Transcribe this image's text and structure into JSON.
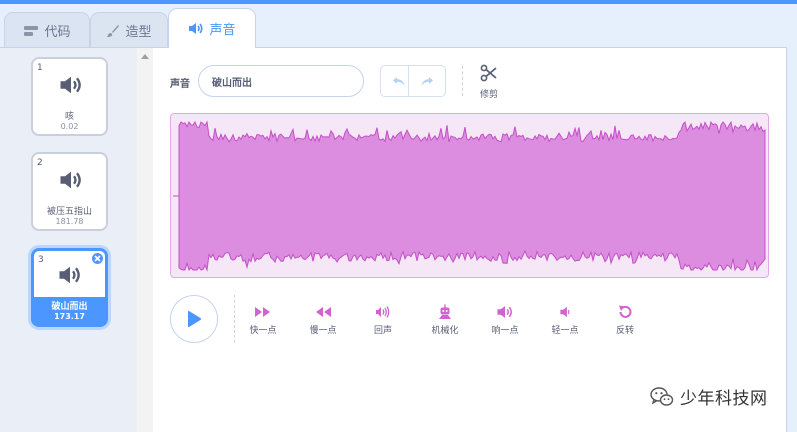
{
  "tabs": [
    {
      "label": "代码",
      "icon": "code-blocks-icon"
    },
    {
      "label": "造型",
      "icon": "paintbrush-icon"
    },
    {
      "label": "声音",
      "icon": "speaker-icon",
      "active": true
    }
  ],
  "sounds": [
    {
      "index": "1",
      "name": "咳",
      "duration": "0.02",
      "icon": "speaker-icon"
    },
    {
      "index": "2",
      "name": "被压五指山",
      "duration": "181.78",
      "icon": "speaker-icon"
    },
    {
      "index": "3",
      "name": "破山而出",
      "duration": "173.17",
      "icon": "speaker-icon",
      "selected": true
    }
  ],
  "editor": {
    "sound_label": "声音",
    "sound_name": "破山而出",
    "trim_label": "修剪",
    "effects": [
      {
        "label": "快一点",
        "icon": "faster-icon"
      },
      {
        "label": "慢一点",
        "icon": "slower-icon"
      },
      {
        "label": "回声",
        "icon": "echo-icon"
      },
      {
        "label": "机械化",
        "icon": "robot-icon"
      },
      {
        "label": "响一点",
        "icon": "louder-icon"
      },
      {
        "label": "轻一点",
        "icon": "softer-icon"
      },
      {
        "label": "反转",
        "icon": "reverse-icon"
      }
    ]
  },
  "watermark": {
    "text": "少年科技网",
    "icon": "wechat-icon"
  },
  "colors": {
    "accent": "#4c97ff",
    "waveform_fill": "#dc8ddf",
    "waveform_stroke": "#c34fc8",
    "waveform_bg": "#f6e7f7",
    "effect_icon": "#cf63cf"
  }
}
